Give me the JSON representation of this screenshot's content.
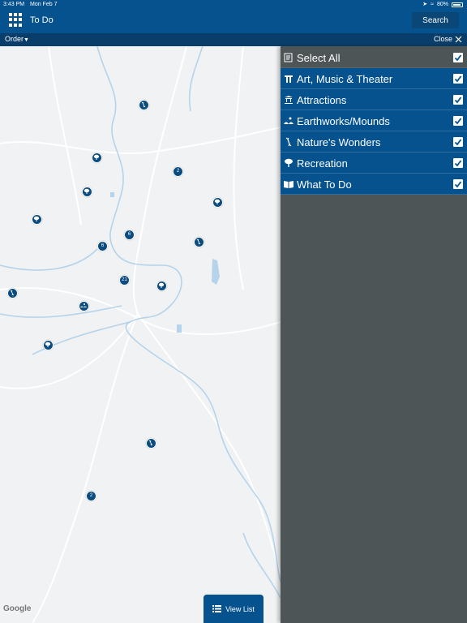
{
  "status_bar": {
    "time": "3:43 PM",
    "date": "Mon Feb 7",
    "battery": "80%"
  },
  "header": {
    "title": "To Do",
    "search_label": "Search"
  },
  "toolbar": {
    "order_label": "Order",
    "close_label": "Close"
  },
  "map": {
    "attribution": "Google",
    "markers": [
      {
        "type": "nature",
        "icon": "nature-icon",
        "label": ""
      },
      {
        "type": "recreation",
        "icon": "tree-icon",
        "label": ""
      },
      {
        "type": "cluster",
        "label": "2"
      },
      {
        "type": "recreation",
        "icon": "tree-icon",
        "label": ""
      },
      {
        "type": "recreation",
        "icon": "tree-icon",
        "label": ""
      },
      {
        "type": "recreation",
        "icon": "tree-icon",
        "label": ""
      },
      {
        "type": "cluster",
        "label": "6"
      },
      {
        "type": "cluster",
        "label": "6"
      },
      {
        "type": "nature",
        "icon": "nature-icon",
        "label": ""
      },
      {
        "type": "cluster",
        "label": "21"
      },
      {
        "type": "recreation",
        "icon": "tree-icon",
        "label": ""
      },
      {
        "type": "nature",
        "icon": "nature-icon",
        "label": ""
      },
      {
        "type": "earthworks",
        "icon": "mounds-icon",
        "label": ""
      },
      {
        "type": "recreation",
        "icon": "tree-icon",
        "label": ""
      },
      {
        "type": "nature",
        "icon": "nature-icon",
        "label": ""
      },
      {
        "type": "cluster",
        "label": "2"
      }
    ]
  },
  "view_list": {
    "label": "View List"
  },
  "filters": [
    {
      "label": "Select All",
      "icon": "select-all-icon",
      "checked": true
    },
    {
      "label": "Art, Music & Theater",
      "icon": "theater-icon",
      "checked": true
    },
    {
      "label": "Attractions",
      "icon": "attractions-icon",
      "checked": true
    },
    {
      "label": "Earthworks/Mounds",
      "icon": "mounds-icon",
      "checked": true
    },
    {
      "label": "Nature's Wonders",
      "icon": "nature-icon",
      "checked": true
    },
    {
      "label": "Recreation",
      "icon": "tree-icon",
      "checked": true
    },
    {
      "label": "What To Do",
      "icon": "book-icon",
      "checked": true
    }
  ],
  "colors": {
    "brand_blue": "#05528f",
    "panel_gray": "#4e5556",
    "water": "#b5d3ea"
  }
}
